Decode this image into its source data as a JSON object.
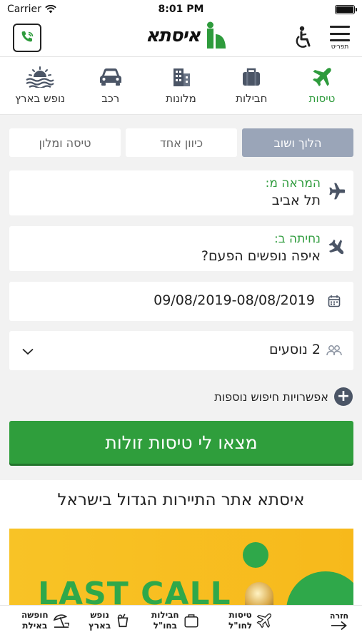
{
  "status_bar": {
    "carrier": "Carrier",
    "time": "8:01 PM"
  },
  "header": {
    "logo_text": "איסתא",
    "menu_label": "תפריט",
    "brand_color": "#2e9b3c"
  },
  "tabs": [
    {
      "label": "טיסות",
      "icon": "plane-icon",
      "active": true
    },
    {
      "label": "חבילות",
      "icon": "suitcase-icon",
      "active": false
    },
    {
      "label": "מלונות",
      "icon": "hotel-icon",
      "active": false
    },
    {
      "label": "רכב",
      "icon": "car-icon",
      "active": false
    },
    {
      "label": "נופש בארץ",
      "icon": "sun-waves-icon",
      "active": false
    }
  ],
  "search": {
    "trip_types": [
      {
        "label": "הלוך ושוב",
        "selected": true
      },
      {
        "label": "כיוון אחד",
        "selected": false
      },
      {
        "label": "טיסה ומלון",
        "selected": false
      }
    ],
    "origin": {
      "label": "המראה מ:",
      "value": "תל אביב"
    },
    "destination": {
      "label": "נחיתה ב:",
      "value": "איפה נופשים הפעם?"
    },
    "dates": {
      "value": "09/08/2019-08/08/2019"
    },
    "passengers": {
      "value": "2 נוסעים"
    },
    "more_options": "אפשרויות חיפוש נוספות",
    "submit_label": "מצאו לי טיסות זולות"
  },
  "content": {
    "headline": "איסתא אתר התיירות הגדול בישראל",
    "banner_text": "LAST CALL",
    "banner_color": "#f8c326"
  },
  "bottom_nav": {
    "back_label": "חזרה",
    "items": [
      {
        "line1": "טיסות",
        "line2": "לחו\"ל",
        "icon": "plane-icon"
      },
      {
        "line1": "חבילות",
        "line2": "בחו\"ל",
        "icon": "suitcase-icon"
      },
      {
        "line1": "נופש",
        "line2": "בארץ",
        "icon": "drink-icon"
      },
      {
        "line1": "חופשה",
        "line2": "באילת",
        "icon": "beach-umbrella-icon"
      }
    ]
  }
}
